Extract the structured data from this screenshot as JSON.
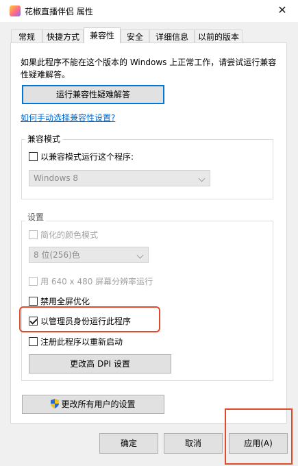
{
  "window": {
    "title": "花椒直播伴侣 属性",
    "close_glyph": "✕"
  },
  "tabs": [
    {
      "label": "常规"
    },
    {
      "label": "快捷方式"
    },
    {
      "label": "兼容性"
    },
    {
      "label": "安全"
    },
    {
      "label": "详细信息"
    },
    {
      "label": "以前的版本"
    }
  ],
  "compat": {
    "description": "如果此程序不能在这个版本的 Windows 上正常工作，请尝试运行兼容性疑难解答。",
    "troubleshooter_button": "运行兼容性疑难解答",
    "manual_link": "如何手动选择兼容性设置?"
  },
  "mode_group": {
    "title": "兼容模式",
    "checkbox_label": "以兼容模式运行这个程序:",
    "checked": false,
    "os_select_value": "Windows 8"
  },
  "settings_group": {
    "title": "设置",
    "reduced_color_label": "简化的颜色模式",
    "color_select_value": "8 位(256)色",
    "resolution_label": "用 640 x 480 屏幕分辨率运行",
    "disable_fullscreen_label": "禁用全屏优化",
    "run_as_admin_label": "以管理员身份运行此程序",
    "run_as_admin_checked": true,
    "register_restart_label": "注册此程序以重新启动",
    "dpi_button": "更改高 DPI 设置"
  },
  "all_users_button": "更改所有用户的设置",
  "footer": {
    "ok": "确定",
    "cancel": "取消",
    "apply": "应用(A)"
  },
  "colors": {
    "annotation": "#e04a2a",
    "link": "#0066cc",
    "focus": "#0078d7"
  }
}
